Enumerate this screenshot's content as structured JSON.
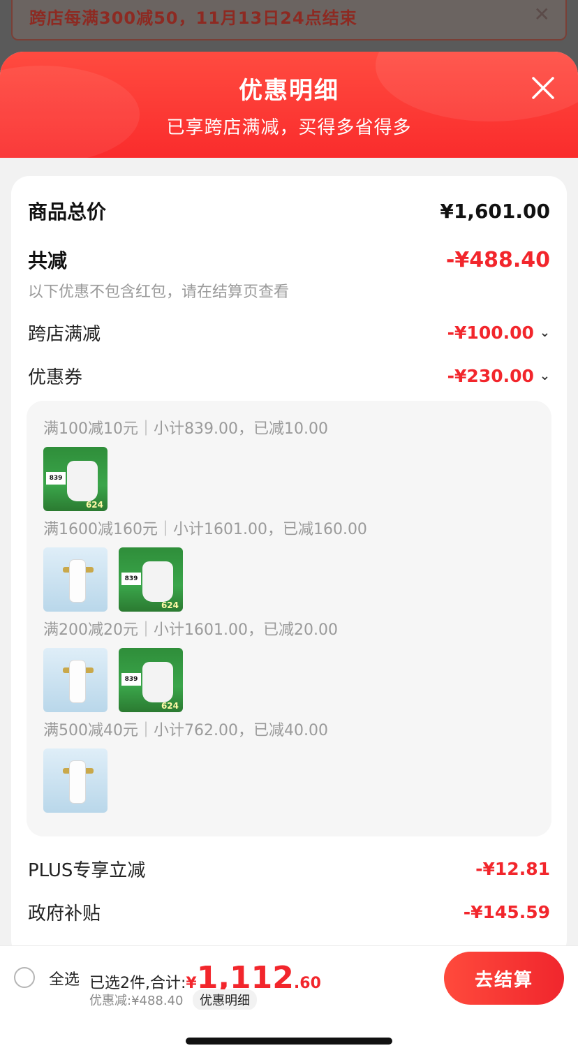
{
  "top_banner": {
    "text": "跨店每满300减50，11月13日24点结束",
    "close": "✕"
  },
  "sheet": {
    "title": "优惠明细",
    "subtitle": "已享跨店满减，买得多省得多"
  },
  "summary": {
    "total_label": "商品总价",
    "total_value": "¥1,601.00",
    "reduce_label": "共减",
    "reduce_value": "-¥488.40",
    "note": "以下优惠不包含红包，请在结算页查看"
  },
  "discounts": {
    "cross_store_label": "跨店满减",
    "cross_store_value": "-¥100.00",
    "coupon_label": "优惠券",
    "coupon_value": "-¥230.00",
    "plus_label": "PLUS专享立减",
    "plus_value": "-¥12.81",
    "gov_label": "政府补贴",
    "gov_value": "-¥145.59"
  },
  "coupons": [
    {
      "text": "满100减10元｜小计839.00，已减10.00",
      "items": [
        "toilet"
      ]
    },
    {
      "text": "满1600减160元｜小计1601.00，已减160.00",
      "items": [
        "filter",
        "toilet"
      ]
    },
    {
      "text": "满200减20元｜小计1601.00，已减20.00",
      "items": [
        "filter",
        "toilet"
      ]
    },
    {
      "text": "满500减40元｜小计762.00，已减40.00",
      "items": [
        "filter"
      ]
    }
  ],
  "product_labels": {
    "toilet_tag": "839",
    "toilet_price": "624"
  },
  "bottom": {
    "select_all": "全选",
    "selected": "已选2件,合计:",
    "currency": "¥",
    "total_int": "1,112",
    "total_dec": ".60",
    "discount": "优惠减:¥488.40",
    "detail": "优惠明细",
    "checkout": "去结算"
  },
  "colors": {
    "accent_red": "#f2262c",
    "header_red": "#fa2c2c"
  }
}
